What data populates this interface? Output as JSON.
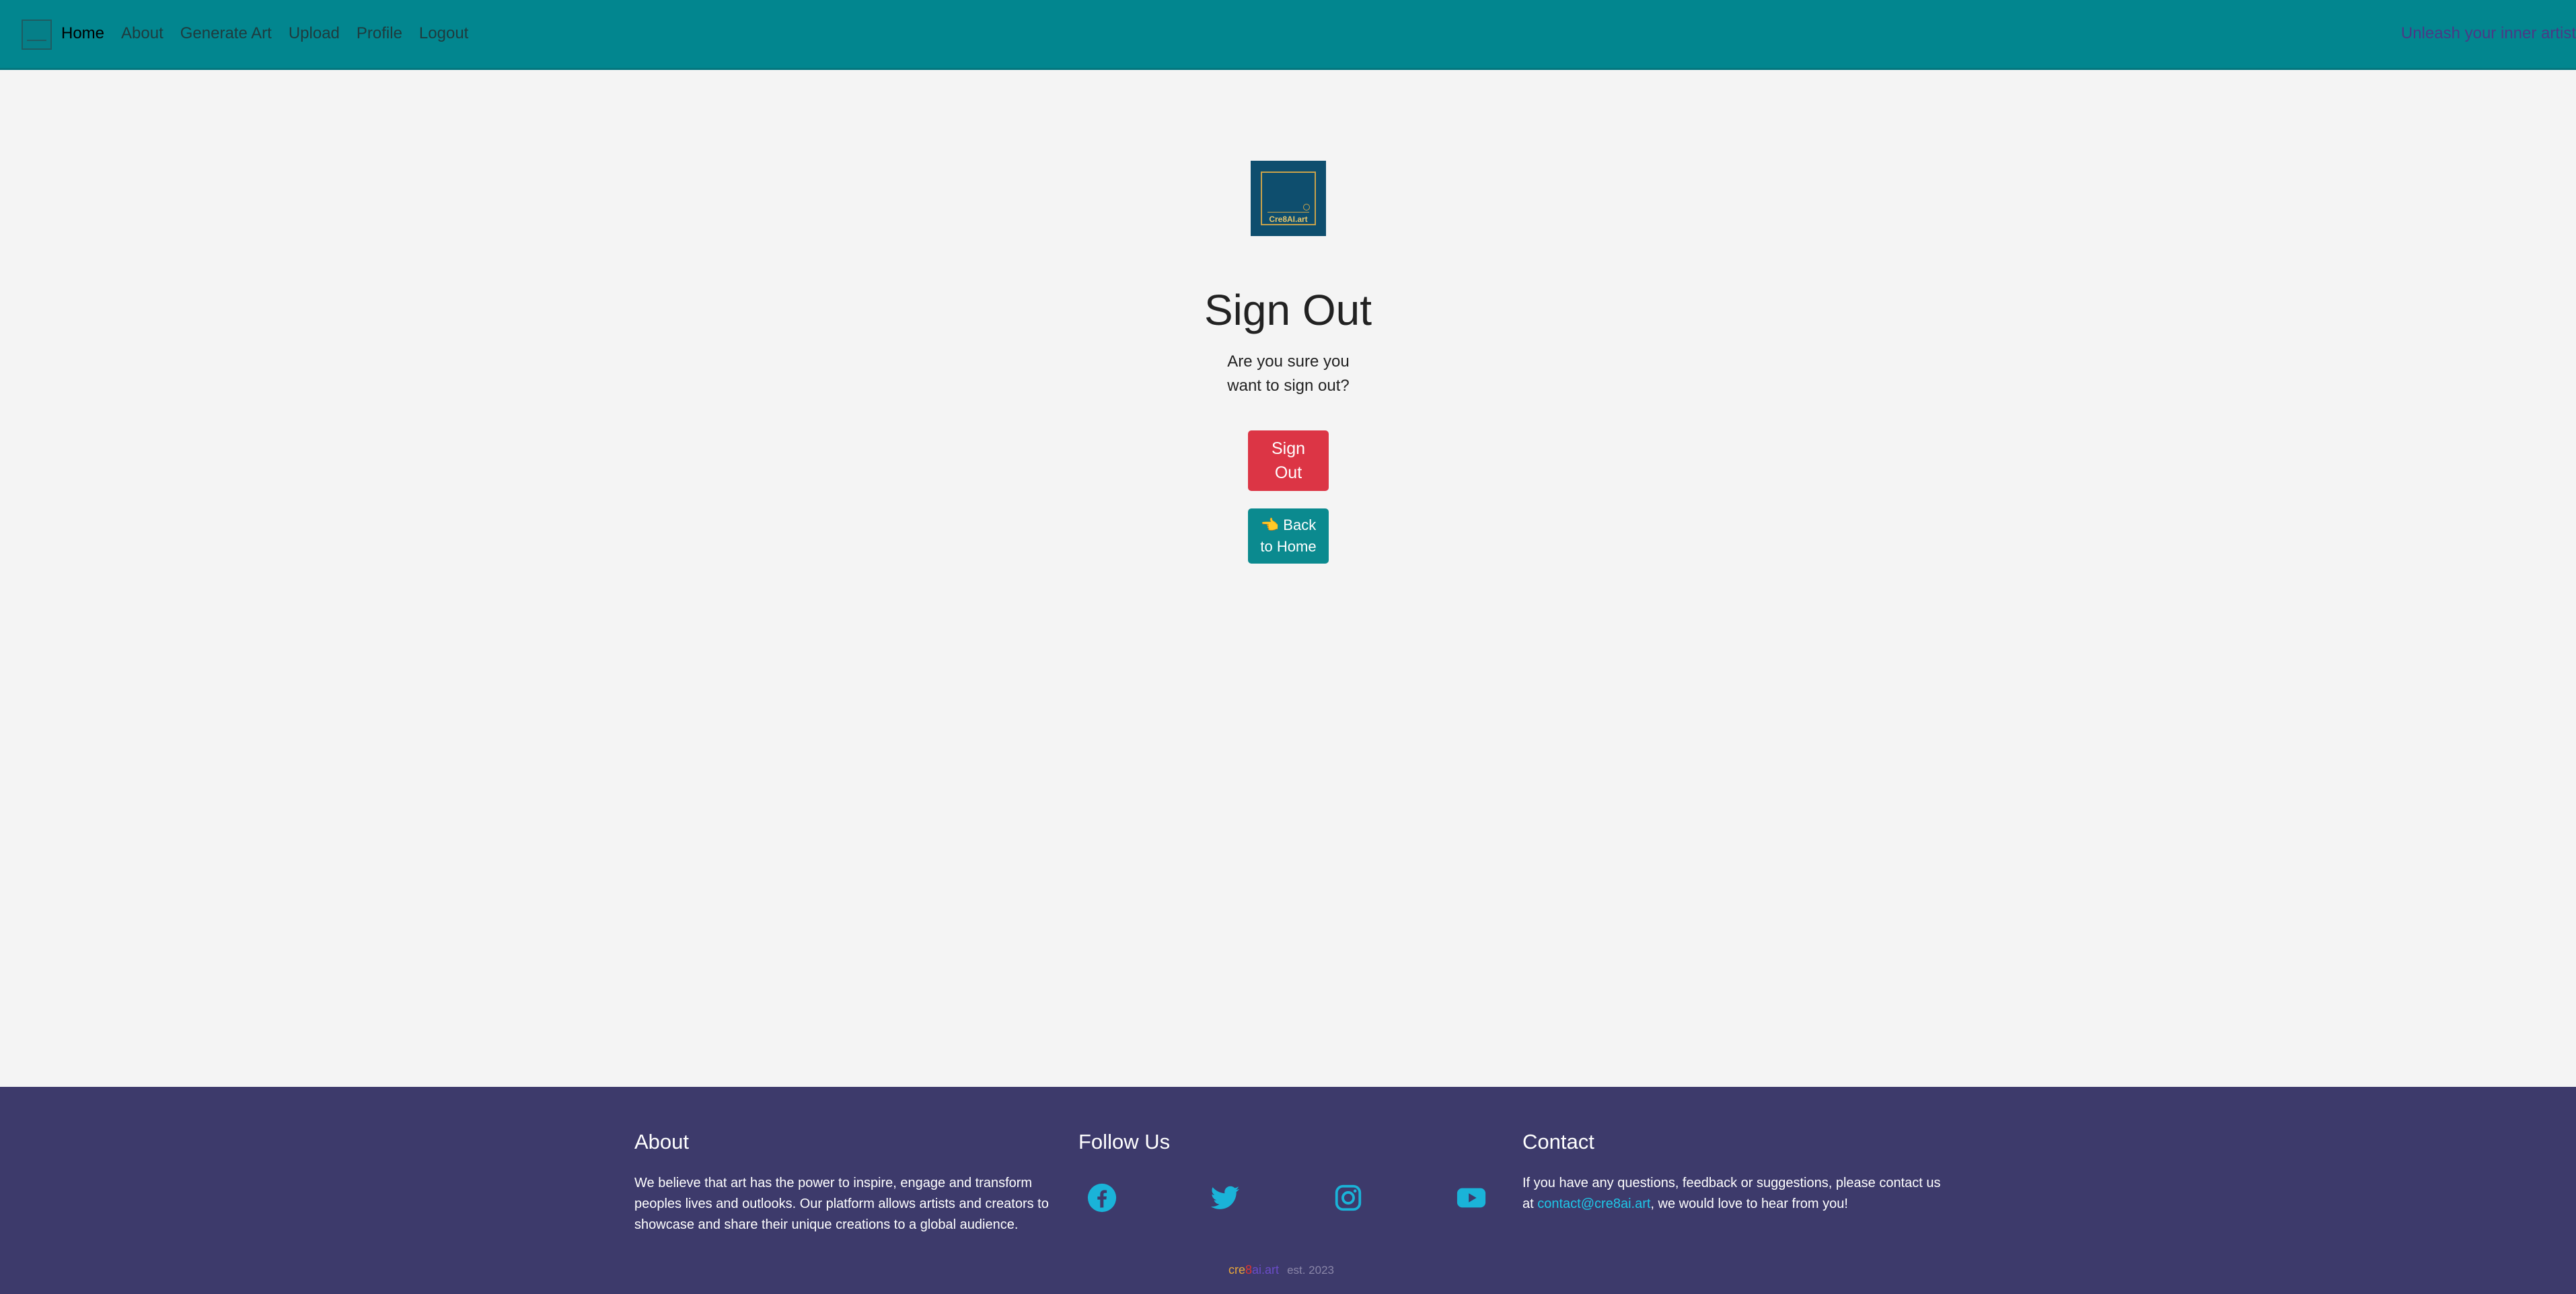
{
  "nav": {
    "links": [
      {
        "label": "Home"
      },
      {
        "label": "About"
      },
      {
        "label": "Generate Art"
      },
      {
        "label": "Upload"
      },
      {
        "label": "Profile"
      },
      {
        "label": "Logout"
      }
    ],
    "tagline": "Unleash your inner artist"
  },
  "main": {
    "logo_text": "Cre8AI.art",
    "title": "Sign Out",
    "confirm_text": "Are you sure you want to sign out?",
    "signout_label": "Sign Out",
    "home_label": "👈 Back to Home"
  },
  "footer": {
    "about": {
      "heading": "About",
      "text": "We believe that art has the power to inspire, engage and transform peoples lives and outlooks. Our platform allows artists and creators to showcase and share their unique creations to a global audience."
    },
    "follow": {
      "heading": "Follow Us",
      "icons": [
        "facebook-icon",
        "twitter-icon",
        "instagram-icon",
        "youtube-icon"
      ]
    },
    "contact": {
      "heading": "Contact",
      "text_before": "If you have any questions, feedback or suggestions, please contact us at ",
      "email": "contact@cre8ai.art",
      "text_after": ", we would love to hear from you!"
    },
    "signature": {
      "part1": "cre",
      "part2": "8",
      "part3": "ai.art",
      "est": "est. 2023"
    }
  },
  "colors": {
    "navbar": "#02868f",
    "footer": "#3d3a6b",
    "signout_button": "#dc3545",
    "home_button": "#0b8a8f",
    "link_accent": "#1ec8e8"
  }
}
